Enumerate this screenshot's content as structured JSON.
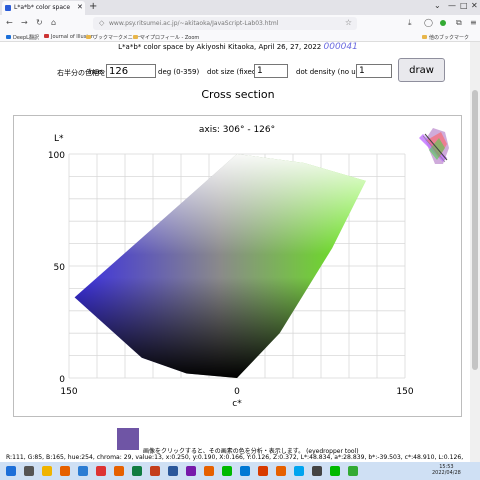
{
  "browser": {
    "tab_title": "L*a*b* color space",
    "url": "www.psy.ritsumei.ac.jp/~akitaoka/JavaScript-Lab03.html",
    "bookmarks": [
      "DeepL翻訳",
      "Journal of Illusion",
      "ブックマークメニュー",
      "マイプロフィール - Zoom",
      "他のブックマーク"
    ]
  },
  "page": {
    "credit": "L*a*b* color space by Akiyoshi Kitaoka, April 26, 27, 2022",
    "counter": "000041"
  },
  "controls": {
    "hint": "右半分の色相を指定",
    "hue_label": "hue:",
    "hue_value": "126",
    "hue_unit": "deg (0-359)",
    "dot_size_label": "dot size (fixed)",
    "dot_size_value": "1",
    "dot_density_label": "dot density (no use)",
    "dot_density_value": "1",
    "draw_label": "draw"
  },
  "section": {
    "title": "Cross section"
  },
  "plot": {
    "axis_title": "axis: 306° - 126°",
    "ylabel": "L*",
    "xlabel": "c*",
    "yticks": [
      "100",
      "50",
      "0"
    ],
    "xticks": [
      "150",
      "0",
      "150"
    ],
    "left_hue_deg": 306,
    "right_hue_deg": 126,
    "gamut_outline": [
      {
        "c": 0,
        "L": 100
      },
      {
        "c": -145,
        "L": 36
      },
      {
        "c": -85,
        "L": 9
      },
      {
        "c": -45,
        "L": 2
      },
      {
        "c": 0,
        "L": 0
      },
      {
        "c": 38,
        "L": 20
      },
      {
        "c": 85,
        "L": 58
      },
      {
        "c": 115,
        "L": 88
      },
      {
        "c": 60,
        "L": 96
      }
    ],
    "colors": {
      "left_hue": "#3a2ee0",
      "right_hue": "#66ee11",
      "grid": "#d9d9d9"
    }
  },
  "eyedropper": {
    "message": "画像をクリックすると、その画素の色を分析・表示します。 (eyedropper tool)",
    "pixel_info": "R:111, G:85, B:165, hue:254, chroma: 29, value:13, x:0.250, y:0.190, X:0.166, Y:0.126, Z:0.372, L*:48.834, a*:28.839, b*:-39.503, c*:48.910, L:0.126,"
  },
  "taskbar": {
    "time": "15:53",
    "date": "2022/04/28"
  }
}
